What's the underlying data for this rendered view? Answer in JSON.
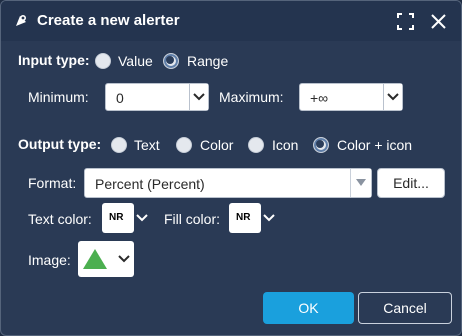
{
  "dialog": {
    "title": "Create a new alerter"
  },
  "input_type": {
    "label": "Input type:",
    "options": [
      "Value",
      "Range"
    ],
    "selected": "Range"
  },
  "range": {
    "minimum_label": "Minimum:",
    "minimum_value": "0",
    "maximum_label": "Maximum:",
    "maximum_value": "+∞"
  },
  "output_type": {
    "label": "Output type:",
    "options": [
      "Text",
      "Color",
      "Icon",
      "Color + icon"
    ],
    "selected": "Color + icon"
  },
  "format": {
    "label": "Format:",
    "value": "Percent (Percent)",
    "edit_label": "Edit..."
  },
  "colors": {
    "text_color_label": "Text color:",
    "text_color_swatch": "NR",
    "fill_color_label": "Fill color:",
    "fill_color_swatch": "NR"
  },
  "image": {
    "label": "Image:",
    "icon": "green-triangle-icon",
    "icon_color": "#4caf50"
  },
  "buttons": {
    "ok": "OK",
    "cancel": "Cancel"
  },
  "theme": {
    "background": "#2a3a55",
    "primary": "#1aa0dd"
  }
}
